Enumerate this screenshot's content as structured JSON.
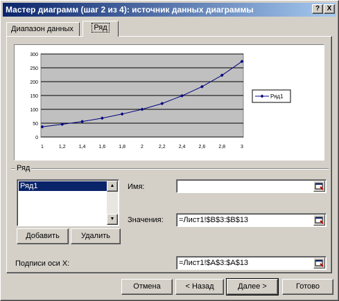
{
  "window": {
    "title": "Мастер диаграмм (шаг 2 из 4): источник данных диаграммы",
    "help_label": "?",
    "close_label": "X"
  },
  "tabs": [
    {
      "label": "Диапазон данных",
      "active": false
    },
    {
      "label": "Ряд",
      "active": true
    }
  ],
  "chart_data": {
    "type": "line",
    "categories": [
      "1",
      "1,2",
      "1,4",
      "1,6",
      "1,8",
      "2",
      "2,2",
      "2,4",
      "2,6",
      "2,8",
      "3"
    ],
    "series": [
      {
        "name": "Ряд1",
        "values": [
          37,
          46,
          56,
          68,
          83,
          100,
          121,
          149,
          182,
          223,
          273
        ],
        "color": "#000080"
      }
    ],
    "y_ticks": [
      "0",
      "50",
      "100",
      "150",
      "200",
      "250",
      "300"
    ],
    "ylim": [
      0,
      300
    ],
    "plot_area_color": "#c0c0c0",
    "grid": true,
    "legend": "right"
  },
  "series_group": {
    "label": "Ряд",
    "items": [
      "Ряд1"
    ],
    "add_label": "Добавить",
    "remove_label": "Удалить",
    "name_label": "Имя:",
    "name_value": "",
    "values_label": "Значения:",
    "values_value": "=Лист1!$B$3:$B$13"
  },
  "x_labels": {
    "label": "Подписи оси X:",
    "value": "=Лист1!$A$3:$A$13"
  },
  "footer": {
    "cancel_label": "Отмена",
    "back_label": "< Назад",
    "next_label": "Далее >",
    "finish_label": "Готово"
  },
  "colors": {
    "titlebar_start": "#0a246a",
    "titlebar_end": "#a6caf0",
    "face": "#d4d0c8",
    "selection": "#0a246a"
  }
}
